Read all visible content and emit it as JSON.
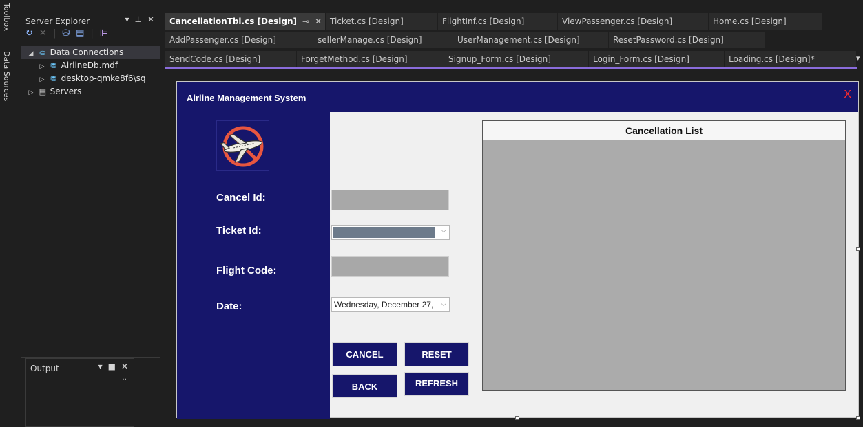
{
  "left_strip": {
    "toolbox": "Toolbox",
    "data_sources": "Data Sources"
  },
  "server_explorer": {
    "title": "Server Explorer",
    "tree": {
      "data_connections": "Data Connections",
      "items": [
        "AirlineDb.mdf",
        "desktop-qmke8f6\\sq"
      ],
      "servers": "Servers"
    }
  },
  "output_panel": {
    "title": "Output"
  },
  "tabs": {
    "row1": [
      "CancellationTbl.cs [Design]",
      "Ticket.cs [Design]",
      "FlightInf.cs [Design]",
      "ViewPassenger.cs [Design]",
      "Home.cs [Design]"
    ],
    "row2": [
      "AddPassenger.cs [Design]",
      "sellerManage.cs [Design]",
      "UserManagement.cs [Design]",
      "ResetPassword.cs [Design]"
    ],
    "row3": [
      "SendCode.cs [Design]",
      "ForgetMethod.cs [Design]",
      "Signup_Form.cs [Design]",
      "Login_Form.cs [Design]",
      "Loading.cs [Design]*"
    ]
  },
  "form": {
    "title": "Airline Management System",
    "close": "X",
    "labels": {
      "cancel_id": "Cancel Id:",
      "ticket_id": "Ticket Id:",
      "flight_code": "Flight Code:",
      "date": "Date:"
    },
    "date_value": "Wednesday, December 27,",
    "buttons": {
      "cancel": "CANCEL",
      "reset": "RESET",
      "back": "BACK",
      "refresh": "REFRESH"
    },
    "grid_title": "Cancellation List"
  },
  "colors": {
    "form_navy": "#16166b",
    "close_red": "#ff2a2a",
    "grid_gray": "#ababab",
    "tab_accent": "#8a6cdb"
  }
}
